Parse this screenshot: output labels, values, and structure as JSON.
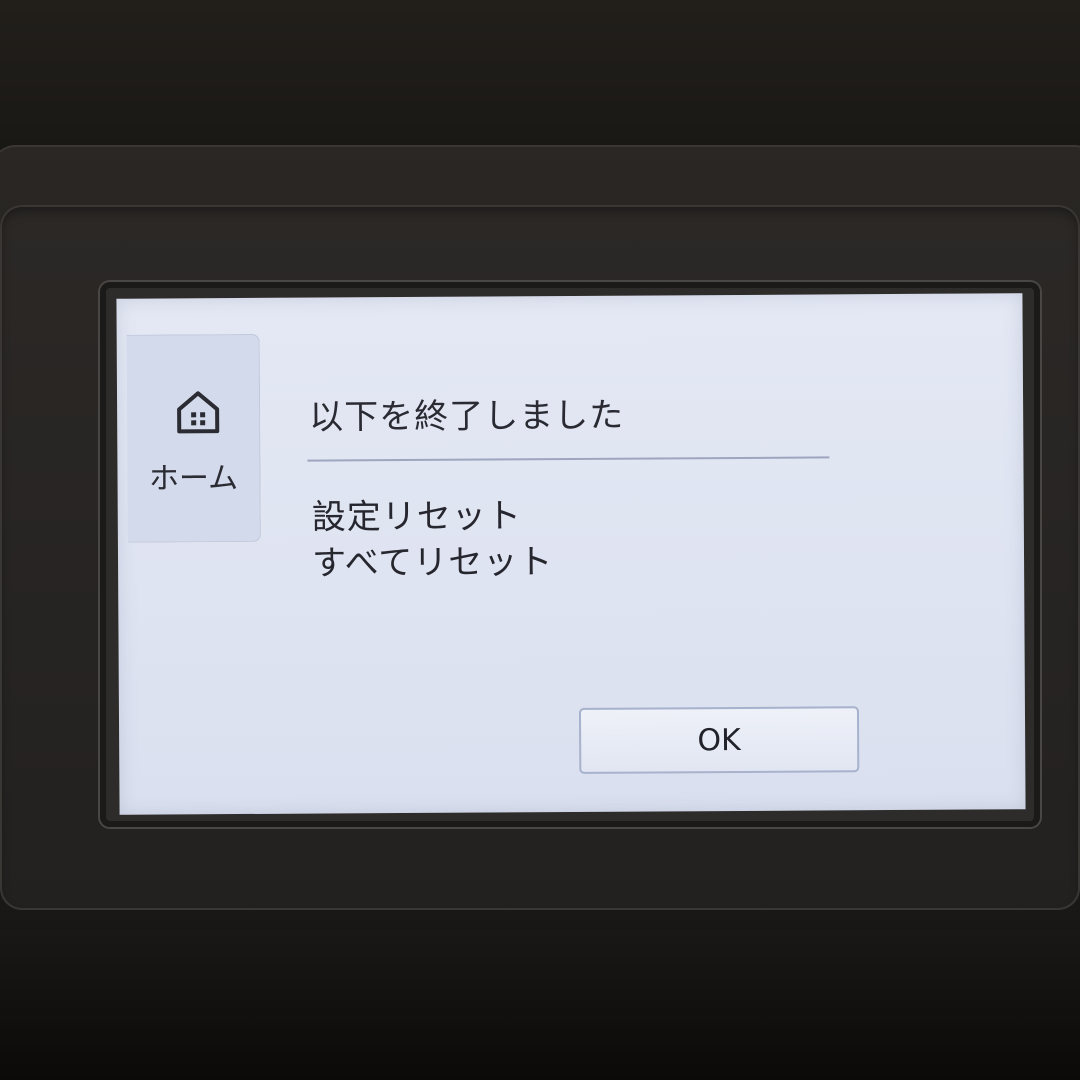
{
  "sidebar": {
    "home_label": "ホーム",
    "home_icon": "home-icon"
  },
  "dialog": {
    "title": "以下を終了しました",
    "items": [
      "設定リセット",
      "すべてリセット"
    ],
    "ok_label": "OK"
  },
  "colors": {
    "screen_background": "#e0e5f2",
    "home_tab_background": "#d3daeb",
    "divider": "#9ea6bf",
    "text": "#2a2a32",
    "button_border": "#a7b2cc"
  }
}
